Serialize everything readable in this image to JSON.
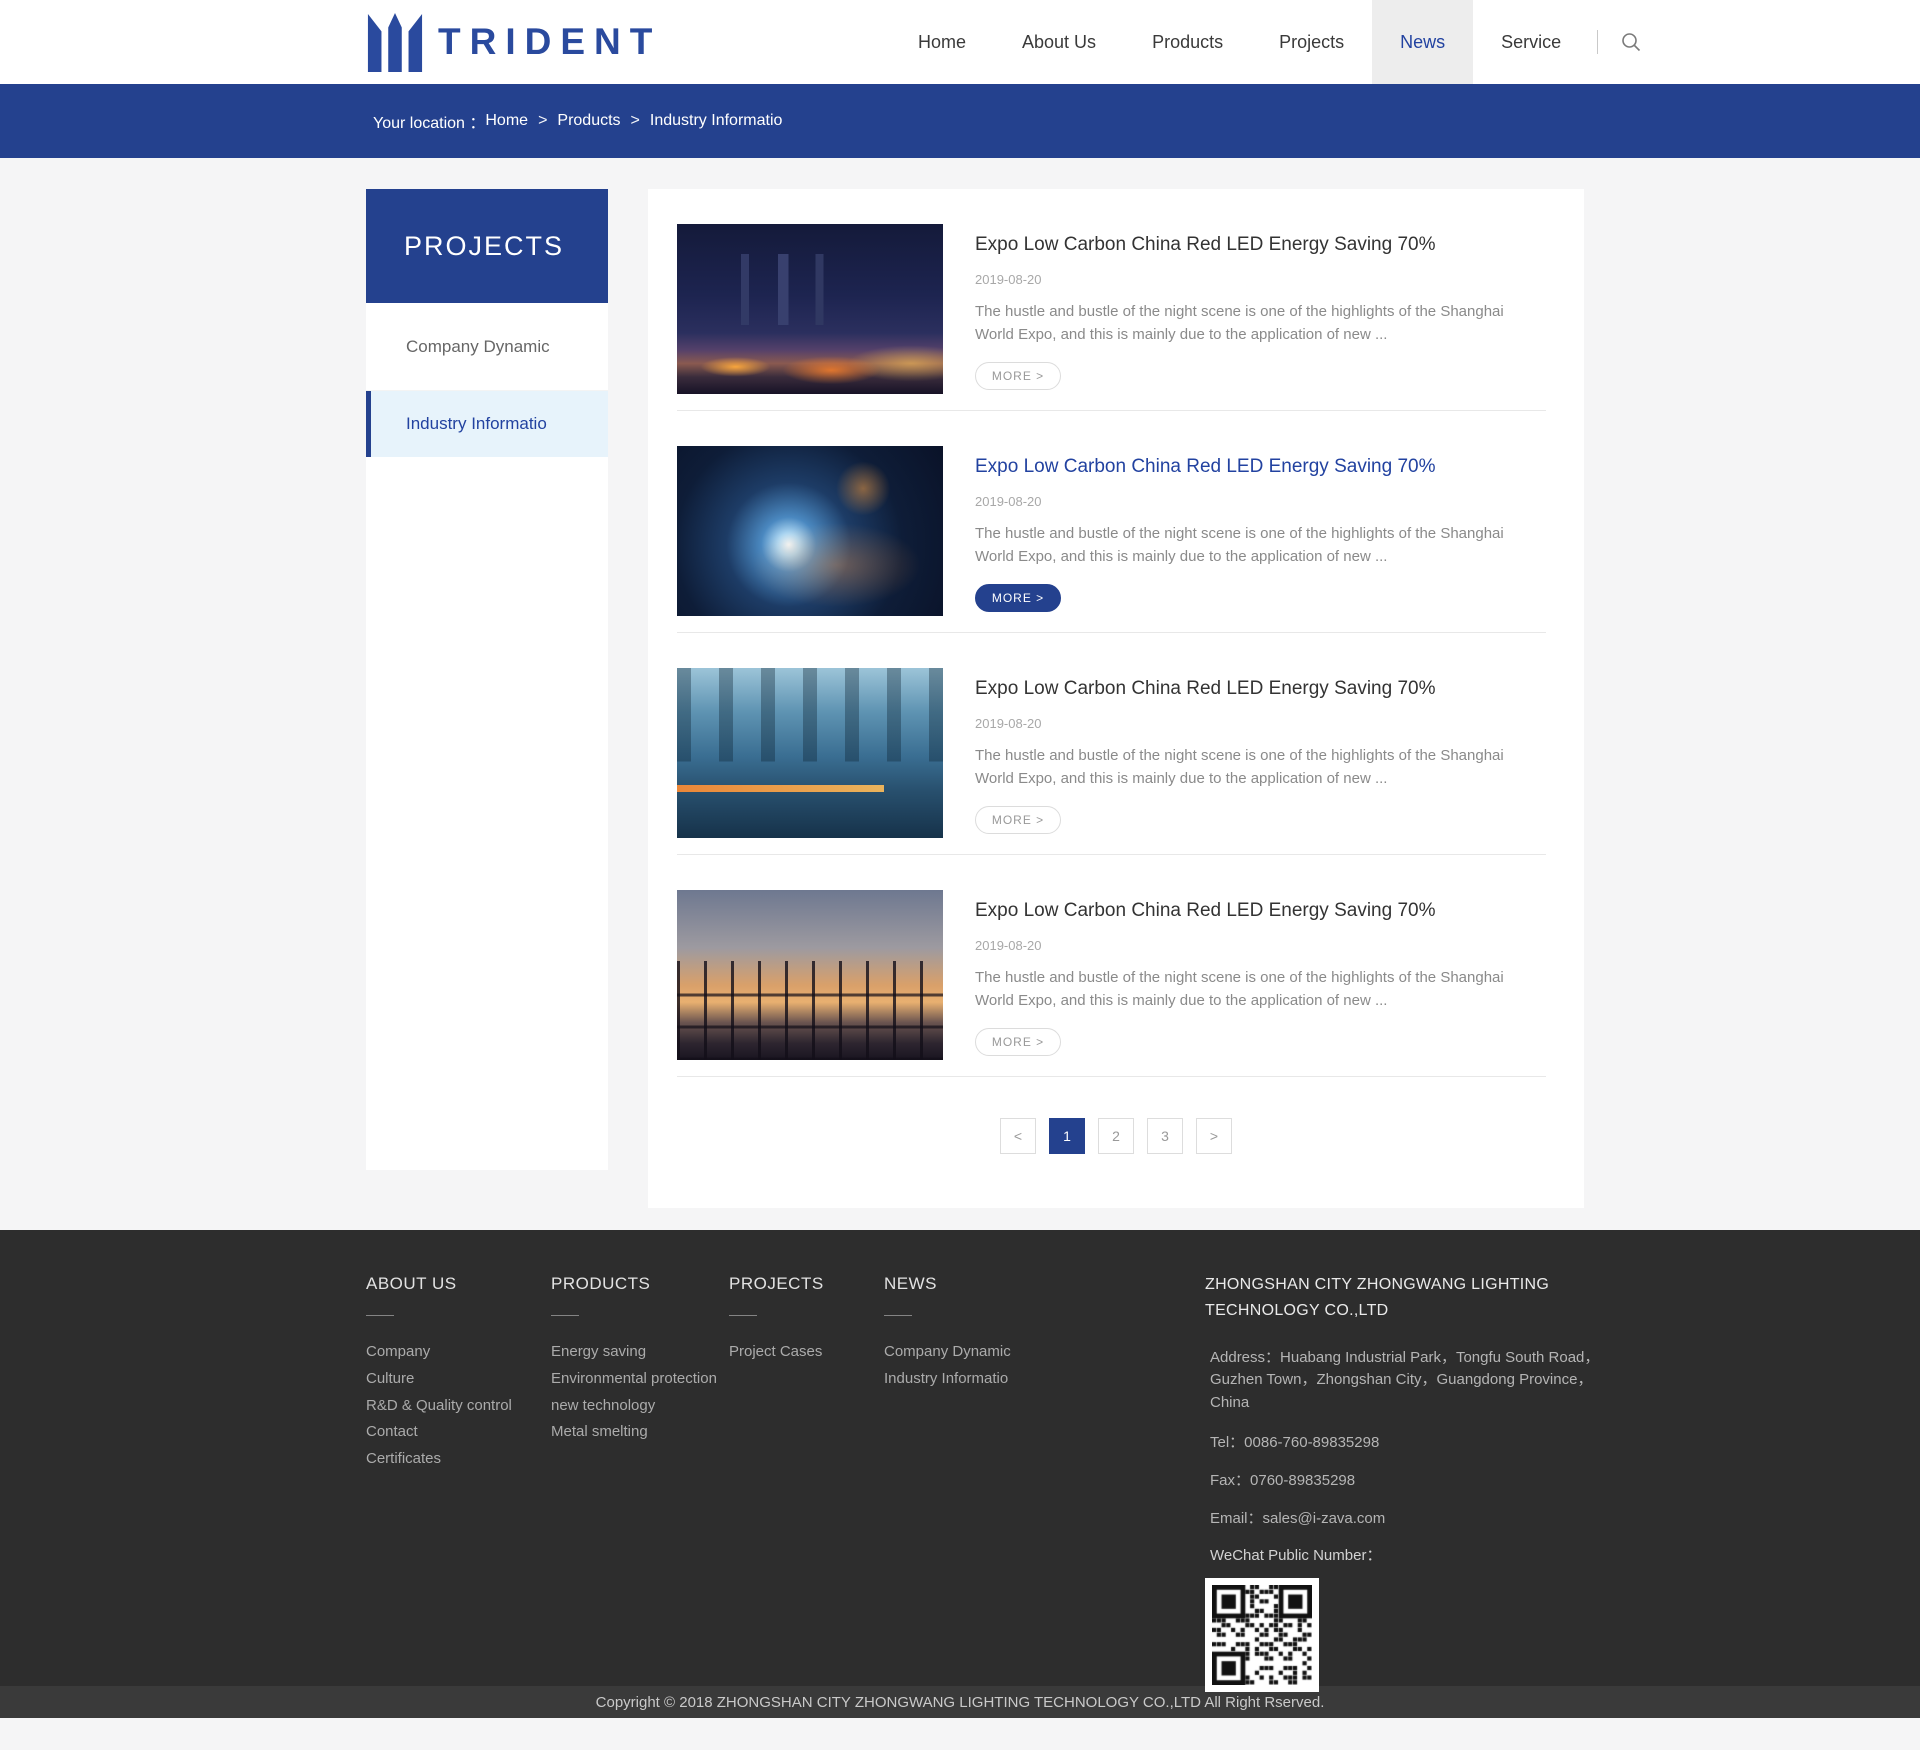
{
  "brand": {
    "name": "TRIDENT",
    "logo_icon": "trident-logo"
  },
  "header": {
    "nav": [
      {
        "label": "Home",
        "active": false
      },
      {
        "label": "About Us",
        "active": false
      },
      {
        "label": "Products",
        "active": false
      },
      {
        "label": "Projects",
        "active": false
      },
      {
        "label": "News",
        "active": true
      },
      {
        "label": "Service",
        "active": false
      }
    ],
    "search_icon": "search-icon"
  },
  "breadcrumb": {
    "prefix": "Your location ：",
    "separator": ">",
    "parts": [
      "Home",
      "Products",
      "Industry Informatio"
    ]
  },
  "sidebar": {
    "title": "PROJECTS",
    "items": [
      {
        "label": "Company Dynamic",
        "active": false
      },
      {
        "label": "Industry Informatio",
        "active": true
      }
    ]
  },
  "news": {
    "items": [
      {
        "title": "Expo Low Carbon China Red LED Energy Saving 70%",
        "date": "2019-08-20",
        "excerpt": "The hustle and bustle of the night scene is one of the highlights of the Shanghai World Expo, and this is mainly due to the application of new ...",
        "more_label": "MORE >",
        "image": "night-plant",
        "highlighted": false
      },
      {
        "title": "Expo Low Carbon China Red LED Energy Saving 70%",
        "date": "2019-08-20",
        "excerpt": "The hustle and bustle of the night scene is one of the highlights of the Shanghai World Expo, and this is mainly due to the application of new ...",
        "more_label": "MORE >",
        "image": "welding",
        "highlighted": true
      },
      {
        "title": "Expo Low Carbon China Red LED Energy Saving 70%",
        "date": "2019-08-20",
        "excerpt": "The hustle and bustle of the night scene is one of the highlights of the Shanghai World Expo, and this is mainly due to the application of new ...",
        "more_label": "MORE >",
        "image": "factory",
        "highlighted": false
      },
      {
        "title": "Expo Low Carbon China Red LED Energy Saving 70%",
        "date": "2019-08-20",
        "excerpt": "The hustle and bustle of the night scene is one of the highlights of the Shanghai World Expo, and this is mainly due to the application of new ...",
        "more_label": "MORE >",
        "image": "construction",
        "highlighted": false
      }
    ]
  },
  "pagination": {
    "prev": "<",
    "pages": [
      "1",
      "2",
      "3"
    ],
    "next": ">",
    "active": "1"
  },
  "footer": {
    "columns": [
      {
        "title": "ABOUT US",
        "links": [
          "Company",
          "Culture",
          "R&D & Quality control",
          "Contact",
          "Certificates"
        ]
      },
      {
        "title": "PRODUCTS",
        "links": [
          "Energy saving",
          "Environmental protection",
          "new technology",
          "Metal smelting"
        ]
      },
      {
        "title": "PROJECTS",
        "links": [
          "Project Cases"
        ]
      },
      {
        "title": "NEWS",
        "links": [
          "Company Dynamic",
          "Industry Informatio"
        ]
      }
    ],
    "company": {
      "name": "ZHONGSHAN CITY ZHONGWANG LIGHTING TECHNOLOGY CO.,LTD",
      "address": "Address：Huabang Industrial Park，Tongfu South Road，Guzhen Town，Zhongshan City，Guangdong Province，China",
      "tel": "Tel：0086-760-89835298",
      "fax": "Fax：0760-89835298",
      "email": "Email：sales@i-zava.com",
      "wechat_label": "WeChat Public Number：",
      "qr_icon": "qr-code"
    },
    "copyright": "Copyright © 2018 ZHONGSHAN CITY ZHONGWANG LIGHTING TECHNOLOGY CO.,LTD All Right Rserved."
  },
  "colors": {
    "accent": "#24418e",
    "logo_blue": "#2a4a9e",
    "nav_active_text": "#2242a0",
    "sidebar_active_bg": "#e7f3fb",
    "footer_bg": "#2d2d2d",
    "copyright_bg": "#3a3a3a"
  }
}
